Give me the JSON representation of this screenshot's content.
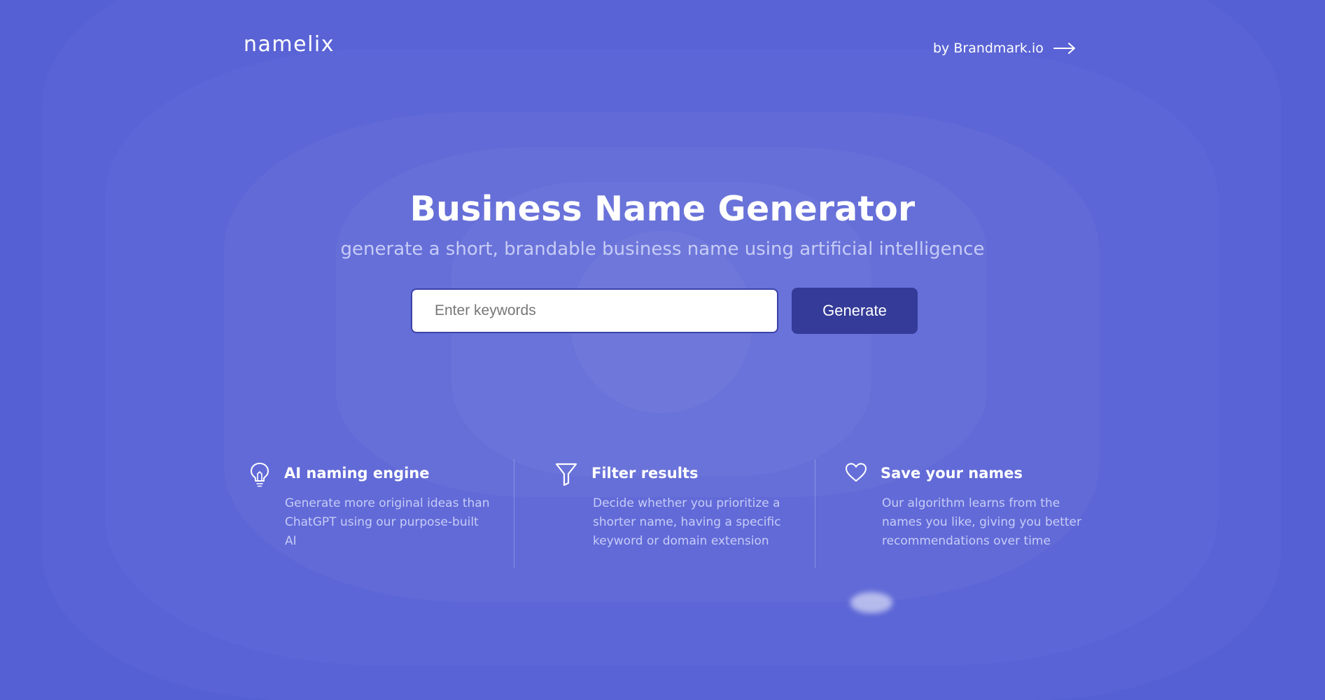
{
  "header": {
    "logo": "namelix",
    "by_link": "by Brandmark.io"
  },
  "hero": {
    "title": "Business Name Generator",
    "subtitle": "generate a short, brandable business name using artificial intelligence"
  },
  "search": {
    "placeholder": "Enter keywords",
    "value": "",
    "button_label": "Generate"
  },
  "features": [
    {
      "icon": "lightbulb-icon",
      "title": "AI naming engine",
      "description": "Generate more original ideas than ChatGPT using our purpose-built AI"
    },
    {
      "icon": "filter-icon",
      "title": "Filter results",
      "description": "Decide whether you prioritize a shorter name, having a specific keyword or domain extension"
    },
    {
      "icon": "heart-icon",
      "title": "Save your names",
      "description": "Our algorithm learns from the names you like, giving you better recommendations over time"
    }
  ],
  "colors": {
    "background": "#5560d4",
    "button": "#343b98",
    "subtitle_text": "#c7ccf7"
  }
}
